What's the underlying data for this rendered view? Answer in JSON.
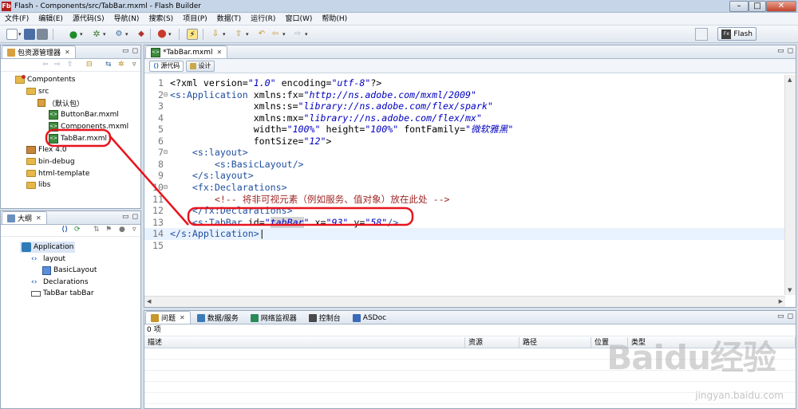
{
  "window": {
    "title": "Flash - Components/src/TabBar.mxml - Flash Builder",
    "controls": {
      "minimize": "–",
      "maximize": "□",
      "close": "✕"
    }
  },
  "menu": [
    "文件(F)",
    "编辑(E)",
    "源代码(S)",
    "导航(N)",
    "搜索(S)",
    "项目(P)",
    "数据(T)",
    "运行(R)",
    "窗口(W)",
    "帮助(H)"
  ],
  "perspective": {
    "label": "Flash"
  },
  "package_explorer": {
    "tab_label": "包资源管理器",
    "tree": [
      {
        "label": "Compontents",
        "icon": "project-icon",
        "indent": 0
      },
      {
        "label": "src",
        "icon": "folder-icon",
        "indent": 1
      },
      {
        "label": "（默认包）",
        "icon": "package-icon",
        "indent": 2
      },
      {
        "label": "ButtonBar.mxml",
        "icon": "mxml-icon",
        "indent": 3
      },
      {
        "label": "Components.mxml",
        "icon": "mxml-icon",
        "indent": 3
      },
      {
        "label": "TabBar.mxml",
        "icon": "mxml-icon",
        "indent": 3
      },
      {
        "label": "Flex 4.0",
        "icon": "library-icon",
        "indent": 1
      },
      {
        "label": "bin-debug",
        "icon": "folder-icon",
        "indent": 1
      },
      {
        "label": "html-template",
        "icon": "folder-icon",
        "indent": 1
      },
      {
        "label": "libs",
        "icon": "folder-icon",
        "indent": 1
      }
    ]
  },
  "outline": {
    "tab_label": "大纲",
    "tree": [
      {
        "label": "Application",
        "icon": "application-icon",
        "indent": 1
      },
      {
        "label": "layout",
        "icon": "code-icon",
        "indent": 2
      },
      {
        "label": "BasicLayout",
        "icon": "layout-icon",
        "indent": 3
      },
      {
        "label": "Declarations",
        "icon": "code-icon",
        "indent": 2
      },
      {
        "label": "TabBar tabBar",
        "icon": "tabbar-icon",
        "indent": 2
      }
    ]
  },
  "editor": {
    "tab_label": "*TabBar.mxml",
    "source_tab": "源代码",
    "design_tab": "设计",
    "lines": [
      {
        "n": "1",
        "fold": "",
        "html": "&lt;?xml version=<span class=\"str\">\"1.0\"</span> encoding=<span class=\"str\">\"utf-8\"</span>?&gt;"
      },
      {
        "n": "2",
        "fold": "⊟",
        "html": "<span class=\"tag\">&lt;s:Application</span> xmlns:fx=<span class=\"str\">\"http://ns.adobe.com/mxml/2009\"</span>"
      },
      {
        "n": "3",
        "fold": "",
        "html": "               xmlns:s=<span class=\"str\">\"library://ns.adobe.com/flex/spark\"</span>"
      },
      {
        "n": "4",
        "fold": "",
        "html": "               xmlns:mx=<span class=\"str\">\"library://ns.adobe.com/flex/mx\"</span>"
      },
      {
        "n": "5",
        "fold": "",
        "html": "               width=<span class=\"str\">\"100%\"</span> height=<span class=\"str\">\"100%\"</span> fontFamily=<span class=\"str\">\"微软雅黑\"</span>"
      },
      {
        "n": "6",
        "fold": "",
        "html": "               fontSize=<span class=\"str\">\"12\"</span>&gt;"
      },
      {
        "n": "7",
        "fold": "⊟",
        "html": "    <span class=\"tag\">&lt;s:layout&gt;</span>"
      },
      {
        "n": "8",
        "fold": "",
        "html": "        <span class=\"tag\">&lt;s:BasicLayout/&gt;</span>"
      },
      {
        "n": "9",
        "fold": "",
        "html": "    <span class=\"tag\">&lt;/s:layout&gt;</span>"
      },
      {
        "n": "10",
        "fold": "⊟",
        "html": "    <span class=\"tag\">&lt;fx:Declarations&gt;</span>"
      },
      {
        "n": "11",
        "fold": "",
        "html": "        <span class=\"cmt\">&lt;!-- 将非可视元素（例如服务、值对象）放在此处 --&gt;</span>"
      },
      {
        "n": "12",
        "fold": "",
        "html": "    <span class=\"tag\">&lt;/fx:Declarations&gt;</span>"
      },
      {
        "n": "13",
        "fold": "",
        "html": "    <span class=\"tag\">&lt;s:TabBar</span> id=<span class=\"str\">\"<span class=\"hl\">tabBar</span>\"</span> x=<span class=\"str\">\"93\"</span> y=<span class=\"str\">\"58\"</span><span class=\"tag\">/&gt;</span>"
      },
      {
        "n": "14",
        "fold": "",
        "html": "<span class=\"tag\">&lt;/s:Application&gt;</span>|",
        "current": true
      },
      {
        "n": "15",
        "fold": "",
        "html": ""
      }
    ]
  },
  "problems": {
    "tabs": [
      "问题",
      "数据/服务",
      "网络监视器",
      "控制台",
      "ASDoc"
    ],
    "count": "0 项",
    "columns": [
      "描述",
      "资源",
      "路径",
      "位置",
      "类型"
    ]
  },
  "watermark": {
    "logo": "Baidu经验",
    "url": "jingyan.baidu.com"
  },
  "colors": {
    "annotation": "#e8141e",
    "accent": "#2e7ab8"
  }
}
